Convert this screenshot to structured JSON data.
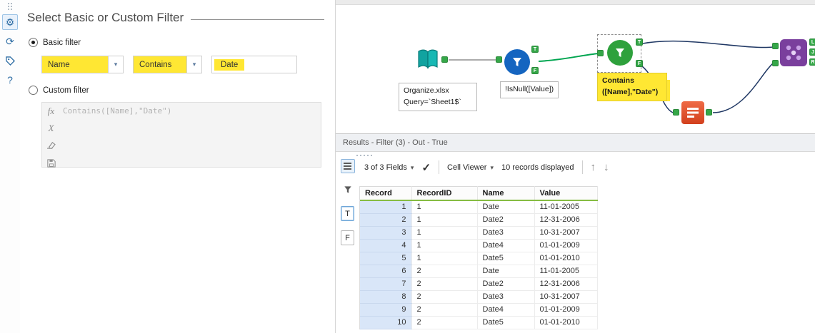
{
  "colors": {
    "highlight": "#ffe733",
    "header_underline": "#86bc42",
    "record_col_bg": "#d9e6f8",
    "accent_green": "#35a748"
  },
  "left_rail": {
    "help_label": "?"
  },
  "config": {
    "title": "Select Basic or Custom Filter",
    "basic_label": "Basic filter",
    "custom_label": "Custom filter",
    "field_value": "Name",
    "operator_value": "Contains",
    "value_text": "Date",
    "expression": "Contains([Name],\"Date\")",
    "fx_label": "fx",
    "x_label": "X"
  },
  "canvas": {
    "tool1_label": "Organize.xlsx\nQuery=`Sheet1$`",
    "tool2_label": "!IsNull([Value])",
    "tool3_label": "Contains\n([Name],\"Date\")",
    "anchor_t": "T",
    "anchor_f": "F",
    "anchor_l": "L",
    "anchor_j": "J",
    "anchor_r": "R"
  },
  "results": {
    "title": "Results - Filter (3) - Out - True",
    "fields_label": "3 of 3 Fields",
    "cell_viewer_label": "Cell Viewer",
    "records_label": "10 records displayed",
    "t_label": "T",
    "f_label": "F",
    "table": {
      "columns": [
        "Record",
        "RecordID",
        "Name",
        "Value"
      ],
      "rows": [
        [
          "1",
          "1",
          "Date",
          "11-01-2005"
        ],
        [
          "2",
          "1",
          "Date2",
          "12-31-2006"
        ],
        [
          "3",
          "1",
          "Date3",
          "10-31-2007"
        ],
        [
          "4",
          "1",
          "Date4",
          "01-01-2009"
        ],
        [
          "5",
          "1",
          "Date5",
          "01-01-2010"
        ],
        [
          "6",
          "2",
          "Date",
          "11-01-2005"
        ],
        [
          "7",
          "2",
          "Date2",
          "12-31-2006"
        ],
        [
          "8",
          "2",
          "Date3",
          "10-31-2007"
        ],
        [
          "9",
          "2",
          "Date4",
          "01-01-2009"
        ],
        [
          "10",
          "2",
          "Date5",
          "01-01-2010"
        ]
      ]
    }
  }
}
